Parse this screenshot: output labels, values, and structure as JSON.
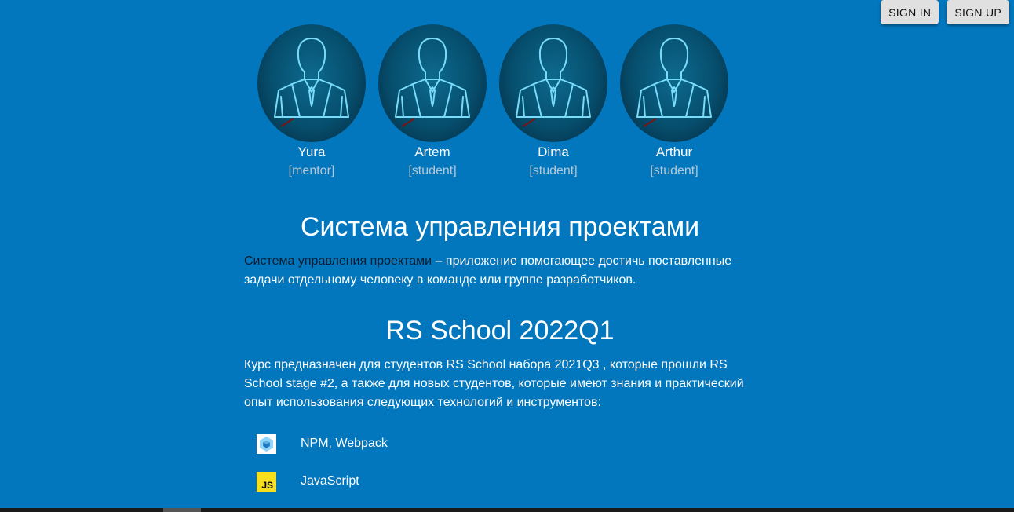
{
  "header": {
    "sign_in": "SIGN IN",
    "sign_up": "SIGN UP"
  },
  "team": [
    {
      "name": "Yura",
      "role": "[mentor]"
    },
    {
      "name": "Artem",
      "role": "[student]"
    },
    {
      "name": "Dima",
      "role": "[student]"
    },
    {
      "name": "Arthur",
      "role": "[student]"
    }
  ],
  "about": {
    "title": "Система управления проектами",
    "highlight": "Система управления проектами",
    "text": " – приложение помогающее достичь поставленные задачи отдельному человеку в команде или группе разработчиков."
  },
  "course": {
    "title": "RS School 2022Q1",
    "text": "Курс предназначен для студентов RS School набора 2021Q3 , которые прошли RS School stage #2, а также для новых студентов, которые имеют знания и практический опыт использования следующих технологий и инструментов:",
    "technologies": [
      {
        "label": "NPM, Webpack",
        "icon": "webpack-icon"
      },
      {
        "label": "JavaScript",
        "icon": "javascript-icon"
      }
    ]
  },
  "colors": {
    "background": "#0277bd",
    "button_bg": "#e0e0e0",
    "role_text": "#b7c7d4",
    "js_yellow": "#f7df1e"
  }
}
